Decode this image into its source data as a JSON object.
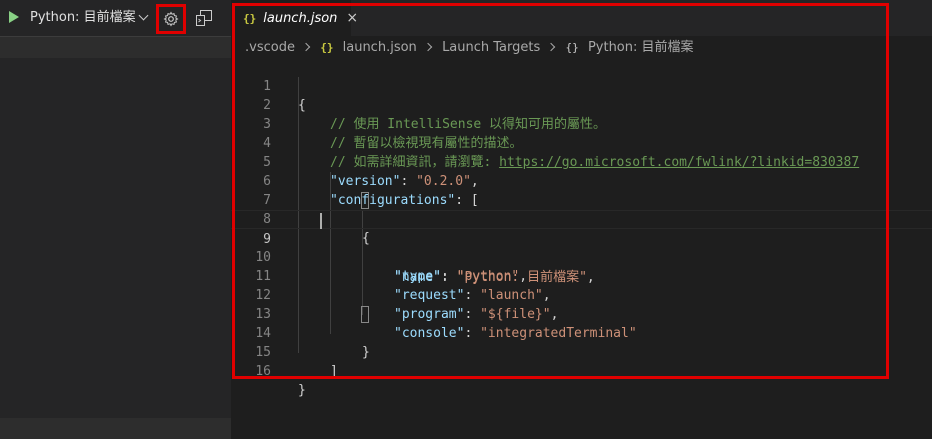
{
  "debug_toolbar": {
    "run_icon": "play-icon",
    "config_label": "Python: 目前檔案",
    "gear_icon": "gear-icon",
    "console_icon": "debug-console-icon"
  },
  "tab": {
    "icon": "{}",
    "label": "launch.json",
    "close": "×"
  },
  "breadcrumb": {
    "folder": ".vscode",
    "file_icon": "{}",
    "file": "launch.json",
    "section": "Launch Targets",
    "obj_icon": "{}",
    "item": "Python: 目前檔案"
  },
  "editor": {
    "line_numbers": [
      "1",
      "2",
      "3",
      "4",
      "5",
      "6",
      "7",
      "8",
      "9",
      "10",
      "11",
      "12",
      "13",
      "14",
      "15",
      "16"
    ],
    "comments": {
      "c1": "// 使用 IntelliSense 以得知可用的屬性。",
      "c2": "// 暫留以檢視現有屬性的描述。",
      "c3_prefix": "// 如需詳細資訊，請瀏覽: ",
      "c3_link": "https://go.microsoft.com/fwlink/?linkid=830387"
    },
    "keys": {
      "version": "\"version\"",
      "configurations": "\"configurations\"",
      "name": "\"name\"",
      "type": "\"type\"",
      "request": "\"request\"",
      "program": "\"program\"",
      "console": "\"console\""
    },
    "values": {
      "version": "\"0.2.0\"",
      "name": "\"Python: 目前檔案\"",
      "type": "\"python\"",
      "request": "\"launch\"",
      "program": "\"${file}\"",
      "console": "\"integratedTerminal\""
    },
    "punct": {
      "open_brace": "{",
      "close_brace": "}",
      "open_bracket": "[",
      "close_bracket": "]",
      "colon": ": ",
      "comma": ","
    }
  }
}
